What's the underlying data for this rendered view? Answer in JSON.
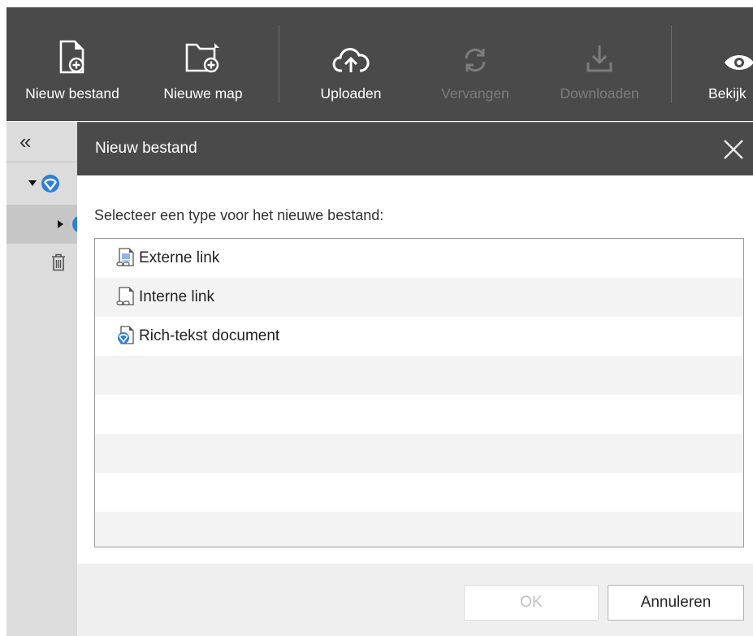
{
  "toolbar": {
    "buttons": [
      {
        "label": "Nieuw bestand",
        "icon": "new-file-icon",
        "enabled": true
      },
      {
        "label": "Nieuwe map",
        "icon": "new-folder-icon",
        "enabled": true
      },
      {
        "label": "Uploaden",
        "icon": "upload-cloud-icon",
        "enabled": true
      },
      {
        "label": "Vervangen",
        "icon": "replace-icon",
        "enabled": false
      },
      {
        "label": "Downloaden",
        "icon": "download-icon",
        "enabled": false
      },
      {
        "label": "Bekijk",
        "icon": "eye-icon",
        "enabled": true
      }
    ]
  },
  "sidebar": {
    "collapse_label": "«",
    "tree": [
      {
        "icon": "site-globe-icon",
        "expanded": true
      },
      {
        "icon": "site-globe-icon",
        "expanded": false,
        "selected": true
      }
    ],
    "trash_icon": "trash-icon"
  },
  "dialog": {
    "title": "Nieuw bestand",
    "prompt": "Selecteer een type voor het nieuwe bestand:",
    "options": [
      {
        "label": "Externe link",
        "icon": "external-link-doc-icon"
      },
      {
        "label": "Interne link",
        "icon": "internal-link-doc-icon"
      },
      {
        "label": "Rich-tekst document",
        "icon": "rich-text-doc-icon"
      }
    ],
    "ok_label": "OK",
    "cancel_label": "Annuleren"
  },
  "colors": {
    "toolbar_bg": "#4a4a4a",
    "accent_blue": "#2f7fd8",
    "disabled_text": "#7c7c7c"
  }
}
